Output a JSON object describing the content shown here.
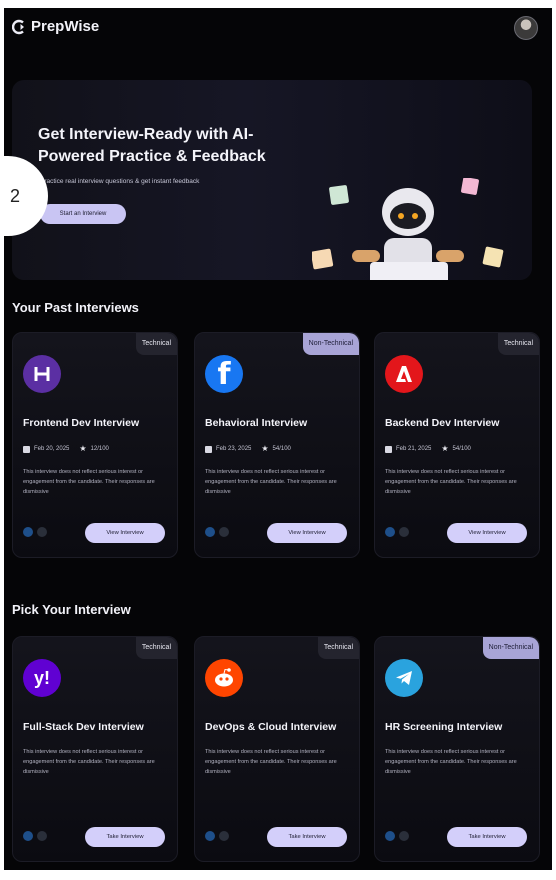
{
  "app": {
    "name": "PrepWise"
  },
  "hero": {
    "title": "Get Interview-Ready with AI-Powered Practice & Feedback",
    "subtitle": "Practice real interview questions & get instant feedback",
    "button_label": "Start an Interview"
  },
  "step_badge": "2",
  "past": {
    "title": "Your Past Interviews",
    "cards": [
      {
        "tag": "Technical",
        "title": "Frontend Dev Interview",
        "date": "Feb 20, 2025",
        "score": "12/100",
        "description": "This interview does not reflect serious interest or engagement from the candidate. Their responses are dismissive",
        "button": "View Interview",
        "brand_color": "#5b2fa3"
      },
      {
        "tag": "Non-Technical",
        "title": "Behavioral Interview",
        "date": "Feb 23, 2025",
        "score": "54/100",
        "description": "This interview does not reflect serious interest or engagement from the candidate. Their responses are dismissive",
        "button": "View Interview",
        "brand_color": "#1877f2"
      },
      {
        "tag": "Technical",
        "title": "Backend Dev Interview",
        "date": "Feb 21, 2025",
        "score": "54/100",
        "description": "This interview does not reflect serious interest or engagement from the candidate. Their responses are dismissive",
        "button": "View Interview",
        "brand_color": "#e3161b"
      }
    ]
  },
  "pick": {
    "title": "Pick Your Interview",
    "cards": [
      {
        "tag": "Technical",
        "title": "Full-Stack Dev Interview",
        "description": "This interview does not reflect serious interest or engagement from the candidate. Their responses are dismissive",
        "button": "Take Interview",
        "brand_color": "#6001d2"
      },
      {
        "tag": "Technical",
        "title": "DevOps & Cloud Interview",
        "description": "This interview does not reflect serious interest or engagement from the candidate. Their responses are dismissive",
        "button": "Take Interview",
        "brand_color": "#ff4500"
      },
      {
        "tag": "Non-Technical",
        "title": "HR Screening Interview",
        "description": "This interview does not reflect serious interest or engagement from the candidate. Their responses are dismissive",
        "button": "Take Interview",
        "brand_color": "#2aa3de"
      }
    ]
  },
  "colors": {
    "background": "#050507",
    "button": "#d3cffa",
    "non_technical_tag": "#a8a4d6"
  }
}
